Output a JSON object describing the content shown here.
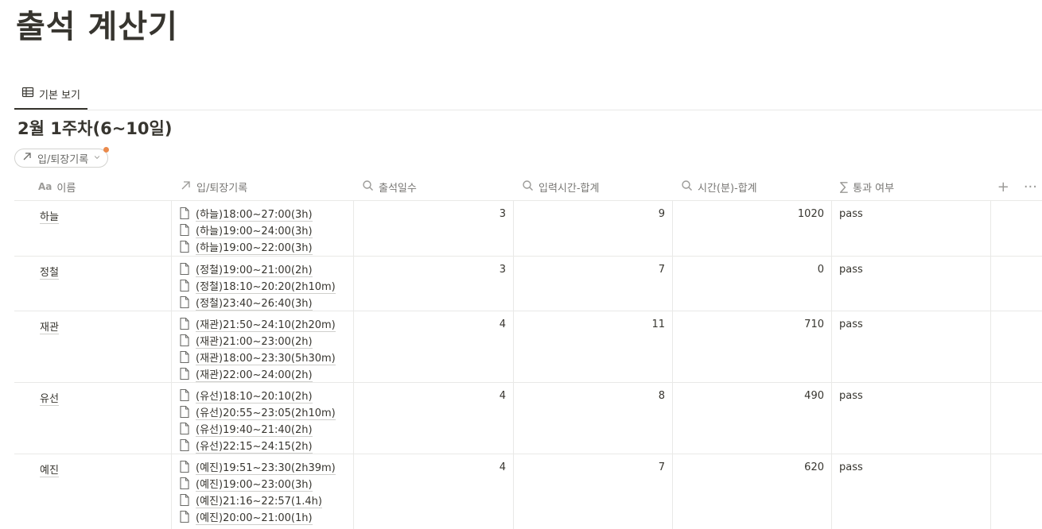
{
  "page": {
    "title": "출석 계산기"
  },
  "view": {
    "tab_label": "기본 보기"
  },
  "group": {
    "title": "2월 1주차(6~10일)"
  },
  "filter": {
    "label": "입/퇴장기록"
  },
  "table": {
    "columns": [
      "이름",
      "입/퇴장기록",
      "출석일수",
      "입력시간-합계",
      "시간(분)-합계",
      "통과 여부"
    ],
    "rows": [
      {
        "name": "하늘",
        "records": [
          "(하늘)18:00~27:00(3h)",
          "(하늘)19:00~24:00(3h)",
          "(하늘)19:00~22:00(3h)"
        ],
        "days": "3",
        "input_hours": "9",
        "minutes": "1020",
        "pass": "pass"
      },
      {
        "name": "정철",
        "records": [
          "(정철)19:00~21:00(2h)",
          "(정철)18:10~20:20(2h10m)",
          "(정철)23:40~26:40(3h)"
        ],
        "days": "3",
        "input_hours": "7",
        "minutes": "0",
        "pass": "pass"
      },
      {
        "name": "재관",
        "records": [
          "(재관)21:50~24:10(2h20m)",
          "(재관)21:00~23:00(2h)",
          "(재관)18:00~23:30(5h30m)",
          "(재관)22:00~24:00(2h)"
        ],
        "days": "4",
        "input_hours": "11",
        "minutes": "710",
        "pass": "pass"
      },
      {
        "name": "유선",
        "records": [
          "(유선)18:10~20:10(2h)",
          "(유선)20:55~23:05(2h10m)",
          "(유선)19:40~21:40(2h)",
          "(유선)22:15~24:15(2h)"
        ],
        "days": "4",
        "input_hours": "8",
        "minutes": "490",
        "pass": "pass"
      },
      {
        "name": "예진",
        "records": [
          "(예진)19:51~23:30(2h39m)",
          "(예진)19:00~23:00(3h)",
          "(예진)21:16~22:57(1.4h)",
          "(예진)20:00~21:00(1h)"
        ],
        "days": "4",
        "input_hours": "7",
        "minutes": "620",
        "pass": "pass"
      }
    ]
  }
}
